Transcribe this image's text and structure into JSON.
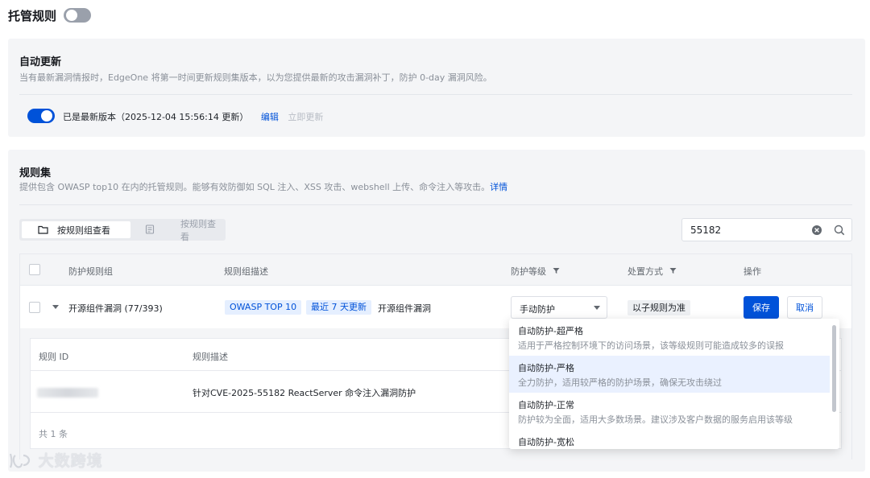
{
  "header": {
    "title": "托管规则"
  },
  "auto_update": {
    "title": "自动更新",
    "desc": "当有最新漏洞情报时，EdgeOne 将第一时间更新规则集版本，以为您提供最新的攻击漏洞补丁，防护 0-day 漏洞风险。",
    "status": "已是最新版本（2025-12-04 15:56:14 更新）",
    "edit": "编辑",
    "update_now": "立即更新"
  },
  "ruleset": {
    "title": "规则集",
    "desc": "提供包含 OWASP top10 在内的托管规则。能够有效防御如 SQL 注入、XSS 攻击、webshell 上传、命令注入等攻击。",
    "detail_link": "详情",
    "view_by_group": "按规则组查看",
    "view_by_rule": "按规则查看",
    "search_value": "55182"
  },
  "table": {
    "columns": [
      "防护规则组",
      "规则组描述",
      "防护等级",
      "处置方式",
      "操作"
    ],
    "row": {
      "group": "开源组件漏洞 (77/393)",
      "tags": [
        "OWASP TOP 10",
        "最近 7 天更新"
      ],
      "desc": "开源组件漏洞",
      "level": "手动防护",
      "action": "以子规则为准",
      "save": "保存",
      "cancel": "取消"
    },
    "sub": {
      "columns": [
        "规则 ID",
        "规则描述"
      ],
      "rows": [
        {
          "desc": "针对CVE-2025-55182 ReactServer 命令注入漏洞防护"
        }
      ],
      "total": "共 1 条"
    }
  },
  "dropdown": {
    "options": [
      {
        "title": "自动防护-超严格",
        "desc": "适用于严格控制环境下的访问场景，该等级规则可能造成较多的误报"
      },
      {
        "title": "自动防护-严格",
        "desc": "全力防护，适用较严格的防护场景，确保无攻击绕过"
      },
      {
        "title": "自动防护-正常",
        "desc": "防护较为全面，适用大多数场景。建议涉及客户数据的服务启用该等级"
      },
      {
        "title": "自动防护-宽松",
        "desc": ""
      }
    ],
    "selected_index": 1
  },
  "watermark": {
    "text": "大数跨境"
  },
  "colors": {
    "primary": "#0052d9",
    "card_bg": "#f4f5f7",
    "selected_bg": "#eaf1ff"
  }
}
